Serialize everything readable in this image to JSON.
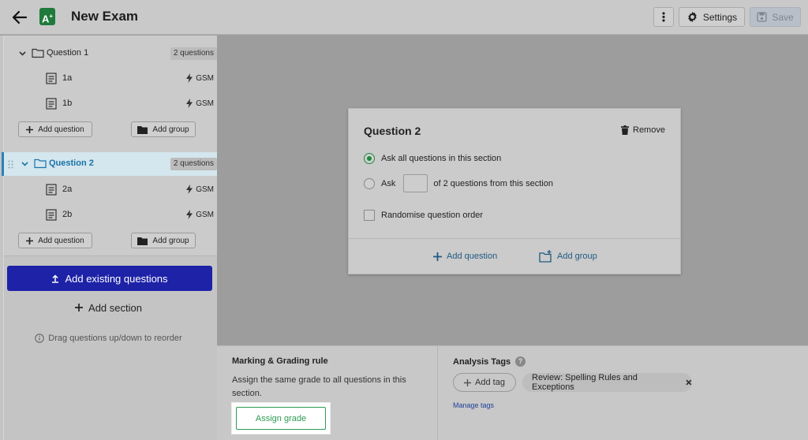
{
  "header": {
    "title": "New Exam",
    "logo_text": "A",
    "logo_sup": "+",
    "settings_label": "Settings",
    "save_label": "Save"
  },
  "tree": {
    "sections": [
      {
        "name": "Question 1",
        "badge": "2 questions",
        "items": [
          {
            "name": "1a",
            "tag": "GSM"
          },
          {
            "name": "1b",
            "tag": "GSM"
          }
        ],
        "add_question_label": "Add question",
        "add_group_label": "Add group"
      },
      {
        "name": "Question 2",
        "badge": "2 questions",
        "items": [
          {
            "name": "2a",
            "tag": "GSM"
          },
          {
            "name": "2b",
            "tag": "GSM"
          }
        ],
        "add_question_label": "Add question",
        "add_group_label": "Add group"
      }
    ]
  },
  "left_actions": {
    "add_existing_label": "Add existing questions",
    "add_section_label": "Add section",
    "hint": "Drag questions up/down to reorder"
  },
  "card": {
    "title": "Question 2",
    "remove_label": "Remove",
    "option_all": "Ask all questions in this section",
    "option_ask": "Ask",
    "option_ask_suffix": "of 2 questions from this section",
    "ask_count_value": "",
    "randomise_label": "Randomise question order",
    "add_question_label": "Add question",
    "add_group_label": "Add group"
  },
  "marking": {
    "title": "Marking & Grading rule",
    "description": "Assign the same grade to all questions in this section.",
    "assign_label": "Assign grade"
  },
  "analysis_tags": {
    "title": "Analysis Tags",
    "help_glyph": "?",
    "add_tag_label": "Add tag",
    "tags": [
      "Review: Spelling Rules and Exceptions"
    ],
    "manage_label": "Manage tags"
  },
  "colors": {
    "primary": "#1d22a7",
    "active_blue": "#1a73a8",
    "success_green": "#2e9b54"
  }
}
